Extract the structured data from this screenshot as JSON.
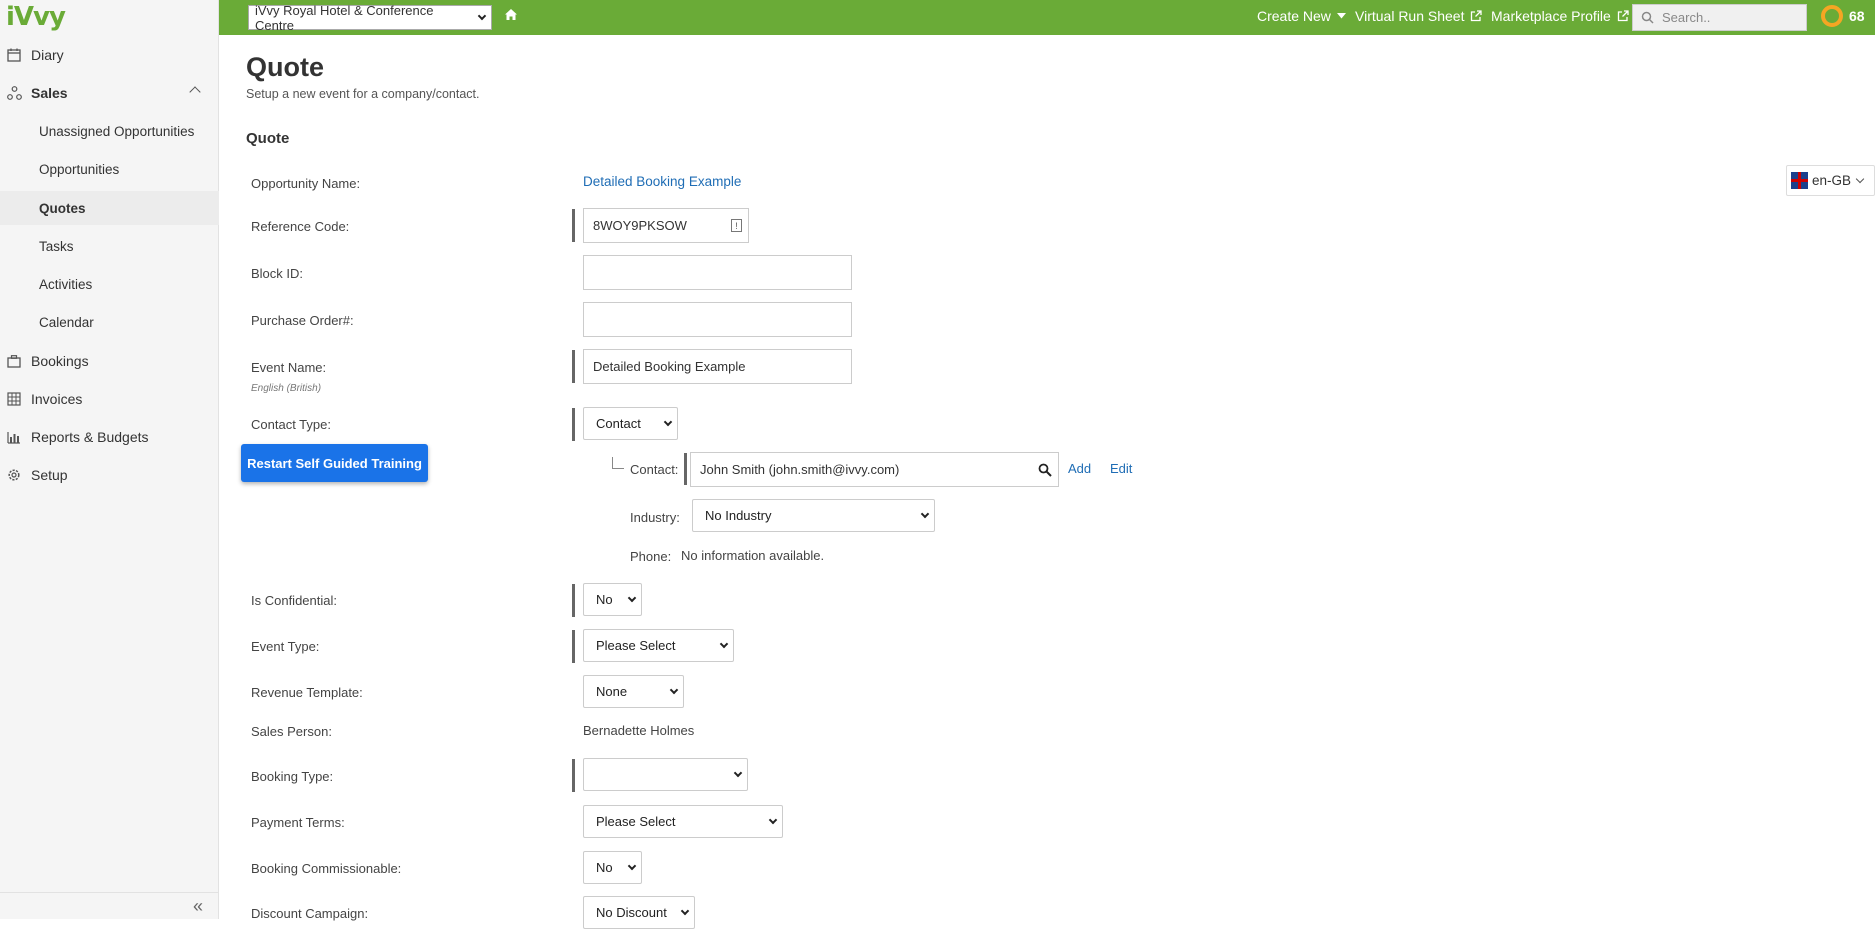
{
  "brand": {
    "logo": "iVvy",
    "accent": "#6aab37"
  },
  "sidebar": {
    "items": [
      {
        "label": "Diary",
        "icon": "calendar-icon"
      },
      {
        "label": "Sales",
        "icon": "network-icon"
      },
      {
        "label": "Unassigned Opportunities"
      },
      {
        "label": "Opportunities"
      },
      {
        "label": "Quotes"
      },
      {
        "label": "Tasks"
      },
      {
        "label": "Activities"
      },
      {
        "label": "Calendar"
      },
      {
        "label": "Bookings",
        "icon": "briefcase-icon"
      },
      {
        "label": "Invoices",
        "icon": "grid-icon"
      },
      {
        "label": "Reports & Budgets",
        "icon": "bar-chart-icon"
      },
      {
        "label": "Setup",
        "icon": "gear-icon"
      }
    ],
    "collapse": "«"
  },
  "training_button": "Restart Self Guided Training",
  "topbar": {
    "venue": "iVvy Royal Hotel & Conference Centre",
    "create_new": "Create New",
    "virtual_run_sheet": "Virtual Run Sheet",
    "marketplace_profile": "Marketplace Profile",
    "search_placeholder": "Search..",
    "score": "68"
  },
  "page": {
    "title": "Quote",
    "subtitle": "Setup a new event for a company/contact.",
    "section": "Quote",
    "language": "en-GB"
  },
  "form": {
    "opportunity_name": {
      "label": "Opportunity Name:",
      "value": "Detailed Booking Example"
    },
    "reference_code": {
      "label": "Reference Code:",
      "value": "8WOY9PKSOW"
    },
    "block_id": {
      "label": "Block ID:",
      "value": ""
    },
    "purchase_order": {
      "label": "Purchase Order#:",
      "value": ""
    },
    "event_name": {
      "label": "Event Name:",
      "note": "English (British)",
      "value": "Detailed Booking Example"
    },
    "contact_type": {
      "label": "Contact Type:",
      "value": "Contact"
    },
    "contact": {
      "label": "Contact:",
      "value": "John Smith (john.smith@ivvy.com)",
      "add": "Add",
      "edit": "Edit"
    },
    "industry": {
      "label": "Industry:",
      "value": "No Industry"
    },
    "phone": {
      "label": "Phone:",
      "value": "No information available."
    },
    "is_confidential": {
      "label": "Is Confidential:",
      "value": "No"
    },
    "event_type": {
      "label": "Event Type:",
      "value": "Please Select"
    },
    "revenue_template": {
      "label": "Revenue Template:",
      "value": "None"
    },
    "sales_person": {
      "label": "Sales Person:",
      "value": "Bernadette Holmes"
    },
    "booking_type": {
      "label": "Booking Type:",
      "value": ""
    },
    "payment_terms": {
      "label": "Payment Terms:",
      "value": "Please Select"
    },
    "booking_commissionable": {
      "label": "Booking Commissionable:",
      "value": "No"
    },
    "discount_campaign": {
      "label": "Discount Campaign:",
      "value": "No Discount"
    }
  }
}
